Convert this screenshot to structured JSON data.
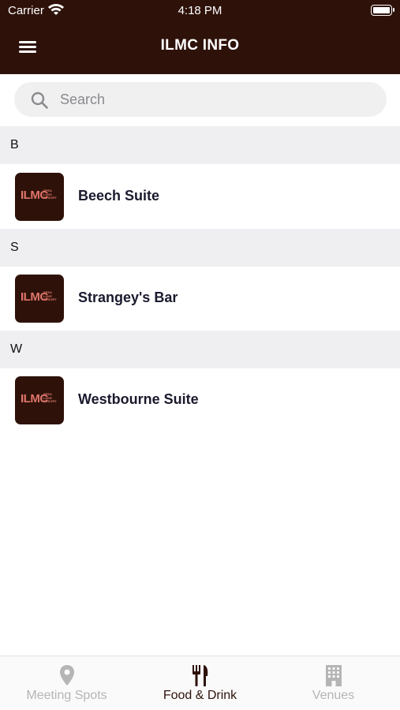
{
  "status_bar": {
    "carrier": "Carrier",
    "time": "4:18 PM"
  },
  "header": {
    "title": "ILMC INFO",
    "menu_icon": "hamburger-menu-icon"
  },
  "search": {
    "placeholder": "Search",
    "icon": "search-icon"
  },
  "sections": [
    {
      "letter": "B",
      "items": [
        {
          "label": "Beech Suite"
        }
      ]
    },
    {
      "letter": "S",
      "items": [
        {
          "label": "Strangey's Bar"
        }
      ]
    },
    {
      "letter": "W",
      "items": [
        {
          "label": "Westbourne Suite"
        }
      ]
    }
  ],
  "logo": {
    "main": "ILMC",
    "sub_lines": [
      "SPEA",
      "LUKE",
      "RESORT"
    ]
  },
  "tabs": [
    {
      "label": "Meeting Spots",
      "icon": "map-pin-icon",
      "active": false
    },
    {
      "label": "Food & Drink",
      "icon": "fork-knife-icon",
      "active": true
    },
    {
      "label": "Venues",
      "icon": "building-icon",
      "active": false
    }
  ],
  "colors": {
    "brand": "#2e120a",
    "logo": "#e0756a",
    "inactive_tab": "#b5b5b5"
  }
}
